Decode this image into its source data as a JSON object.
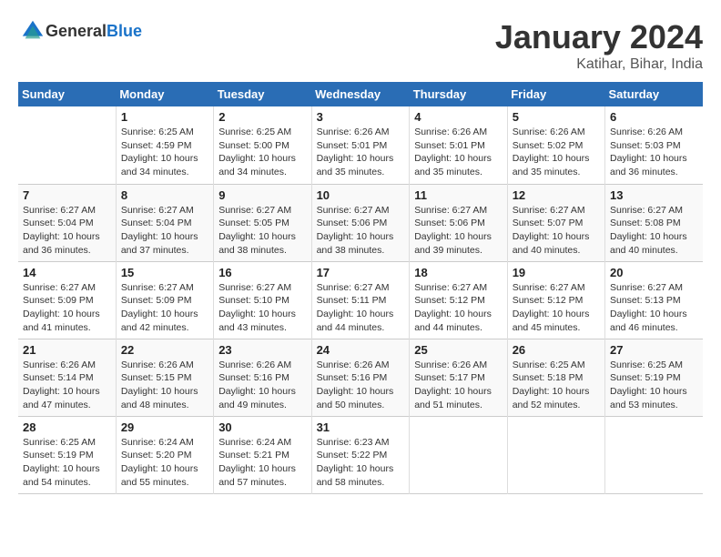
{
  "logo": {
    "text_general": "General",
    "text_blue": "Blue"
  },
  "title": "January 2024",
  "subtitle": "Katihar, Bihar, India",
  "days_header": [
    "Sunday",
    "Monday",
    "Tuesday",
    "Wednesday",
    "Thursday",
    "Friday",
    "Saturday"
  ],
  "weeks": [
    [
      {
        "day": "",
        "info": ""
      },
      {
        "day": "1",
        "info": "Sunrise: 6:25 AM\nSunset: 4:59 PM\nDaylight: 10 hours\nand 34 minutes."
      },
      {
        "day": "2",
        "info": "Sunrise: 6:25 AM\nSunset: 5:00 PM\nDaylight: 10 hours\nand 34 minutes."
      },
      {
        "day": "3",
        "info": "Sunrise: 6:26 AM\nSunset: 5:01 PM\nDaylight: 10 hours\nand 35 minutes."
      },
      {
        "day": "4",
        "info": "Sunrise: 6:26 AM\nSunset: 5:01 PM\nDaylight: 10 hours\nand 35 minutes."
      },
      {
        "day": "5",
        "info": "Sunrise: 6:26 AM\nSunset: 5:02 PM\nDaylight: 10 hours\nand 35 minutes."
      },
      {
        "day": "6",
        "info": "Sunrise: 6:26 AM\nSunset: 5:03 PM\nDaylight: 10 hours\nand 36 minutes."
      }
    ],
    [
      {
        "day": "7",
        "info": "Sunrise: 6:27 AM\nSunset: 5:04 PM\nDaylight: 10 hours\nand 36 minutes."
      },
      {
        "day": "8",
        "info": "Sunrise: 6:27 AM\nSunset: 5:04 PM\nDaylight: 10 hours\nand 37 minutes."
      },
      {
        "day": "9",
        "info": "Sunrise: 6:27 AM\nSunset: 5:05 PM\nDaylight: 10 hours\nand 38 minutes."
      },
      {
        "day": "10",
        "info": "Sunrise: 6:27 AM\nSunset: 5:06 PM\nDaylight: 10 hours\nand 38 minutes."
      },
      {
        "day": "11",
        "info": "Sunrise: 6:27 AM\nSunset: 5:06 PM\nDaylight: 10 hours\nand 39 minutes."
      },
      {
        "day": "12",
        "info": "Sunrise: 6:27 AM\nSunset: 5:07 PM\nDaylight: 10 hours\nand 40 minutes."
      },
      {
        "day": "13",
        "info": "Sunrise: 6:27 AM\nSunset: 5:08 PM\nDaylight: 10 hours\nand 40 minutes."
      }
    ],
    [
      {
        "day": "14",
        "info": "Sunrise: 6:27 AM\nSunset: 5:09 PM\nDaylight: 10 hours\nand 41 minutes."
      },
      {
        "day": "15",
        "info": "Sunrise: 6:27 AM\nSunset: 5:09 PM\nDaylight: 10 hours\nand 42 minutes."
      },
      {
        "day": "16",
        "info": "Sunrise: 6:27 AM\nSunset: 5:10 PM\nDaylight: 10 hours\nand 43 minutes."
      },
      {
        "day": "17",
        "info": "Sunrise: 6:27 AM\nSunset: 5:11 PM\nDaylight: 10 hours\nand 44 minutes."
      },
      {
        "day": "18",
        "info": "Sunrise: 6:27 AM\nSunset: 5:12 PM\nDaylight: 10 hours\nand 44 minutes."
      },
      {
        "day": "19",
        "info": "Sunrise: 6:27 AM\nSunset: 5:12 PM\nDaylight: 10 hours\nand 45 minutes."
      },
      {
        "day": "20",
        "info": "Sunrise: 6:27 AM\nSunset: 5:13 PM\nDaylight: 10 hours\nand 46 minutes."
      }
    ],
    [
      {
        "day": "21",
        "info": "Sunrise: 6:26 AM\nSunset: 5:14 PM\nDaylight: 10 hours\nand 47 minutes."
      },
      {
        "day": "22",
        "info": "Sunrise: 6:26 AM\nSunset: 5:15 PM\nDaylight: 10 hours\nand 48 minutes."
      },
      {
        "day": "23",
        "info": "Sunrise: 6:26 AM\nSunset: 5:16 PM\nDaylight: 10 hours\nand 49 minutes."
      },
      {
        "day": "24",
        "info": "Sunrise: 6:26 AM\nSunset: 5:16 PM\nDaylight: 10 hours\nand 50 minutes."
      },
      {
        "day": "25",
        "info": "Sunrise: 6:26 AM\nSunset: 5:17 PM\nDaylight: 10 hours\nand 51 minutes."
      },
      {
        "day": "26",
        "info": "Sunrise: 6:25 AM\nSunset: 5:18 PM\nDaylight: 10 hours\nand 52 minutes."
      },
      {
        "day": "27",
        "info": "Sunrise: 6:25 AM\nSunset: 5:19 PM\nDaylight: 10 hours\nand 53 minutes."
      }
    ],
    [
      {
        "day": "28",
        "info": "Sunrise: 6:25 AM\nSunset: 5:19 PM\nDaylight: 10 hours\nand 54 minutes."
      },
      {
        "day": "29",
        "info": "Sunrise: 6:24 AM\nSunset: 5:20 PM\nDaylight: 10 hours\nand 55 minutes."
      },
      {
        "day": "30",
        "info": "Sunrise: 6:24 AM\nSunset: 5:21 PM\nDaylight: 10 hours\nand 57 minutes."
      },
      {
        "day": "31",
        "info": "Sunrise: 6:23 AM\nSunset: 5:22 PM\nDaylight: 10 hours\nand 58 minutes."
      },
      {
        "day": "",
        "info": ""
      },
      {
        "day": "",
        "info": ""
      },
      {
        "day": "",
        "info": ""
      }
    ]
  ]
}
